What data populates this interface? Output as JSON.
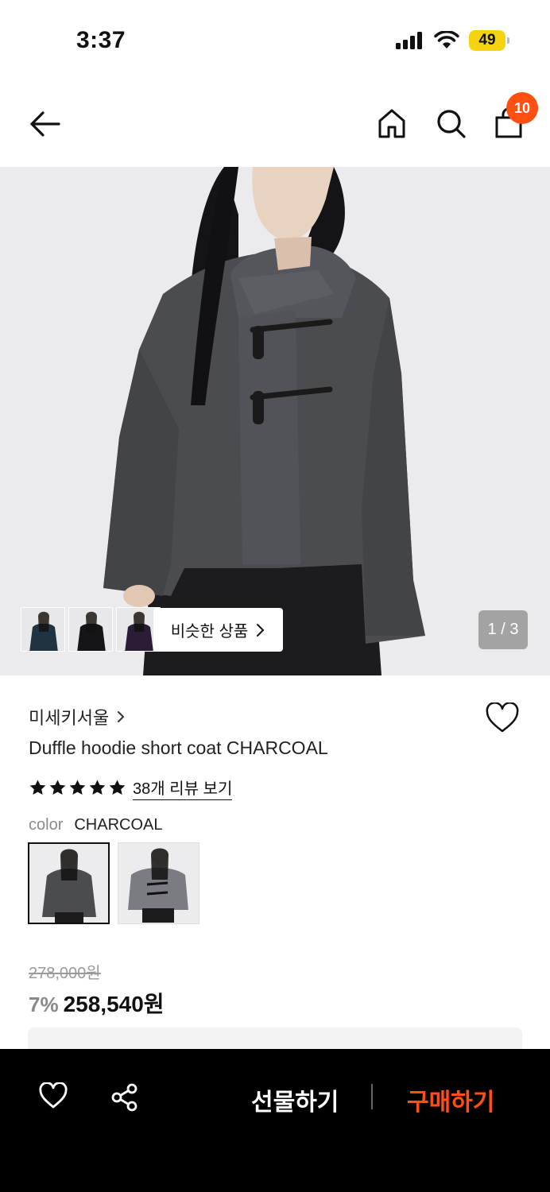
{
  "status_bar": {
    "time": "3:37",
    "battery": "49"
  },
  "nav": {
    "cart_count": "10"
  },
  "gallery": {
    "similar_label": "비슷한 상품",
    "page_indicator": "1 / 3"
  },
  "product": {
    "brand": "미세키서울",
    "title": "Duffle hoodie short coat CHARCOAL",
    "rating": 5,
    "review_link": "38개 리뷰 보기",
    "color_label": "color",
    "color_value": "CHARCOAL",
    "original_price": "278,000원",
    "discount": "7%",
    "final_price": "258,540원"
  },
  "bottom_bar": {
    "gift_label": "선물하기",
    "buy_label": "구매하기"
  },
  "colors": {
    "accent": "#ff4f12",
    "coat": "#4b4c50",
    "coat_light": "#6a6b70"
  }
}
